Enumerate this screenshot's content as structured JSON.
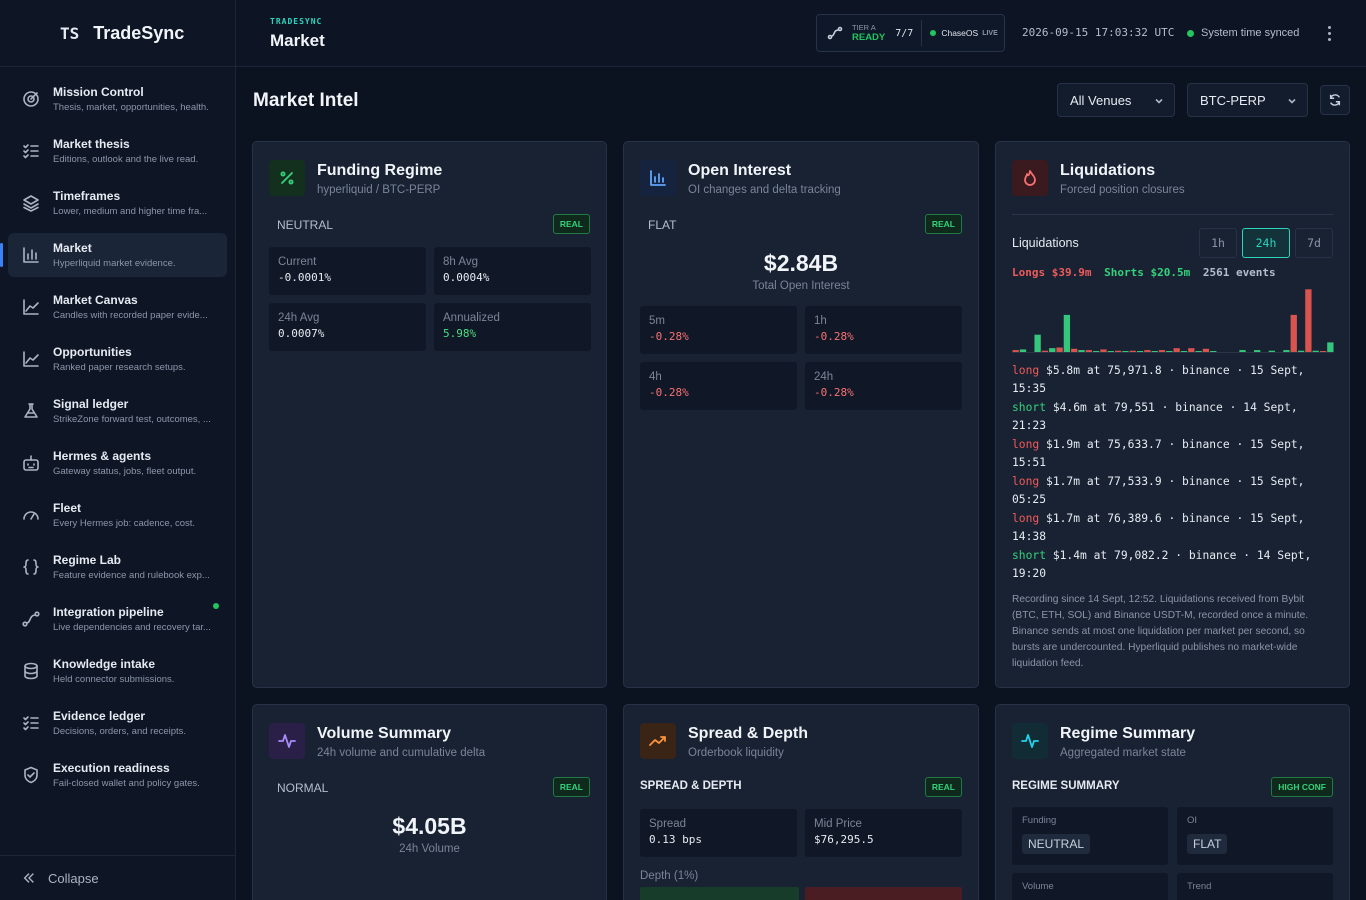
{
  "brand": {
    "logo": "TS",
    "name": "TradeSync"
  },
  "sidebar": {
    "items": [
      {
        "label": "Mission Control",
        "desc": "Thesis, market, opportunities, health.",
        "icon": "target-icon",
        "active": false
      },
      {
        "label": "Market thesis",
        "desc": "Editions, outlook and the live read.",
        "icon": "list-check-icon",
        "active": false
      },
      {
        "label": "Timeframes",
        "desc": "Lower, medium and higher time fra...",
        "icon": "layers-icon",
        "active": false
      },
      {
        "label": "Market",
        "desc": "Hyperliquid market evidence.",
        "icon": "bar-chart-icon",
        "active": true
      },
      {
        "label": "Market Canvas",
        "desc": "Candles with recorded paper evide...",
        "icon": "trend-line-icon",
        "active": false
      },
      {
        "label": "Opportunities",
        "desc": "Ranked paper research setups.",
        "icon": "trend-line-icon",
        "active": false
      },
      {
        "label": "Signal ledger",
        "desc": "StrikeZone forward test, outcomes, ...",
        "icon": "flask-icon",
        "active": false
      },
      {
        "label": "Hermes & agents",
        "desc": "Gateway status, jobs, fleet output.",
        "icon": "bot-icon",
        "active": false
      },
      {
        "label": "Fleet",
        "desc": "Every Hermes job: cadence, cost.",
        "icon": "gauge-icon",
        "active": false
      },
      {
        "label": "Regime Lab",
        "desc": "Feature evidence and rulebook exp...",
        "icon": "braces-icon",
        "active": false
      },
      {
        "label": "Integration pipeline",
        "desc": "Live dependencies and recovery tar...",
        "icon": "route-icon",
        "active": false,
        "dot": true
      },
      {
        "label": "Knowledge intake",
        "desc": "Held connector submissions.",
        "icon": "database-icon",
        "active": false
      },
      {
        "label": "Evidence ledger",
        "desc": "Decisions, orders, and receipts.",
        "icon": "list-check-icon",
        "active": false
      },
      {
        "label": "Execution readiness",
        "desc": "Fail-closed wallet and policy gates.",
        "icon": "shield-check-icon",
        "active": false
      }
    ],
    "collapse_label": "Collapse"
  },
  "header": {
    "eyebrow": "TRADESYNC",
    "title": "Market",
    "tier_label": "TIER A",
    "tier_status": "READY",
    "tier_count": "7/7",
    "os_name": "ChaseOS",
    "os_status": "LIVE",
    "timestamp": "2026-09-15 17:03:32 UTC",
    "sync_status": "System time synced"
  },
  "page": {
    "title": "Market Intel",
    "venue_select": "All Venues",
    "symbol_select": "BTC-PERP"
  },
  "funding": {
    "title": "Funding Regime",
    "subtitle": "hyperliquid / BTC-PERP",
    "state": "NEUTRAL",
    "badge": "REAL",
    "tiles": [
      {
        "label": "Current",
        "value": "-0.0001%"
      },
      {
        "label": "8h Avg",
        "value": "0.0004%"
      },
      {
        "label": "24h Avg",
        "value": "0.0007%"
      },
      {
        "label": "Annualized",
        "value": "5.98%"
      }
    ]
  },
  "oi": {
    "title": "Open Interest",
    "subtitle": "OI changes and delta tracking",
    "state": "FLAT",
    "badge": "REAL",
    "total_value": "$2.84B",
    "total_label": "Total Open Interest",
    "tiles": [
      {
        "label": "5m",
        "value": "-0.28%"
      },
      {
        "label": "1h",
        "value": "-0.28%"
      },
      {
        "label": "4h",
        "value": "-0.28%"
      },
      {
        "label": "24h",
        "value": "-0.28%"
      }
    ]
  },
  "liquidations": {
    "title": "Liquidations",
    "subtitle": "Forced position closures",
    "heading": "Liquidations",
    "timeframes": [
      "1h",
      "24h",
      "7d"
    ],
    "active_timeframe": "24h",
    "longs": "Longs $39.9m",
    "shorts": "Shorts $20.5m",
    "events": "2561 events",
    "feed": [
      {
        "side": "long",
        "text": "$5.8m at 75,971.8 · binance · 15 Sept, 15:35"
      },
      {
        "side": "short",
        "text": "$4.6m at 79,551 · binance · 14 Sept, 21:23"
      },
      {
        "side": "long",
        "text": "$1.9m at 75,633.7 · binance · 15 Sept, 15:51"
      },
      {
        "side": "long",
        "text": "$1.7m at 77,533.9 · binance · 15 Sept, 05:25"
      },
      {
        "side": "long",
        "text": "$1.7m at 76,389.6 · binance · 15 Sept, 14:38"
      },
      {
        "side": "short",
        "text": "$1.4m at 79,082.2 · binance · 14 Sept, 19:20"
      }
    ],
    "note": "Recording since 14 Sept, 12:52. Liquidations received from Bybit (BTC, ETH, SOL) and Binance USDT-M, recorded once a minute. Binance sends at most one liquidation per market per second, so bursts are undercounted. Hyperliquid publishes no market-wide liquidation feed."
  },
  "chart_data": {
    "type": "bar",
    "series": [
      {
        "name": "Longs",
        "color": "#d9534f",
        "values": [
          0.3,
          0,
          0.2,
          0.7,
          0.5,
          0.3,
          0.4,
          0.2,
          0.2,
          0.3,
          0.3,
          0.6,
          0.6,
          0.5,
          0,
          0,
          0,
          0,
          0,
          5.8,
          9.8,
          0.1
        ]
      },
      {
        "name": "Shorts",
        "color": "#34c77b",
        "values": [
          0.4,
          2.7,
          0.6,
          5.8,
          0.3,
          0.1,
          0.1,
          0.1,
          0.1,
          0.1,
          0.1,
          0.1,
          0.1,
          0.1,
          0,
          0.3,
          0.3,
          0.2,
          0.3,
          0.2,
          0.2,
          1.5
        ]
      }
    ],
    "ylim": [
      0,
      10
    ]
  },
  "volume": {
    "title": "Volume Summary",
    "subtitle": "24h volume and cumulative delta",
    "state": "NORMAL",
    "badge": "REAL",
    "total_value": "$4.05B",
    "total_label": "24h Volume"
  },
  "spread": {
    "title": "Spread & Depth",
    "subtitle": "Orderbook liquidity",
    "section": "SPREAD & DEPTH",
    "badge": "REAL",
    "tiles": [
      {
        "label": "Spread",
        "value": "0.13 bps"
      },
      {
        "label": "Mid Price",
        "value": "$76,295.5"
      }
    ],
    "depth_label": "Depth (1%)"
  },
  "regime": {
    "title": "Regime Summary",
    "subtitle": "Aggregated market state",
    "section": "REGIME SUMMARY",
    "badge": "HIGH CONF",
    "tiles": [
      {
        "label": "Funding",
        "value": "NEUTRAL"
      },
      {
        "label": "OI",
        "value": "FLAT"
      },
      {
        "label": "Volume",
        "value": ""
      },
      {
        "label": "Trend",
        "value": ""
      }
    ]
  }
}
